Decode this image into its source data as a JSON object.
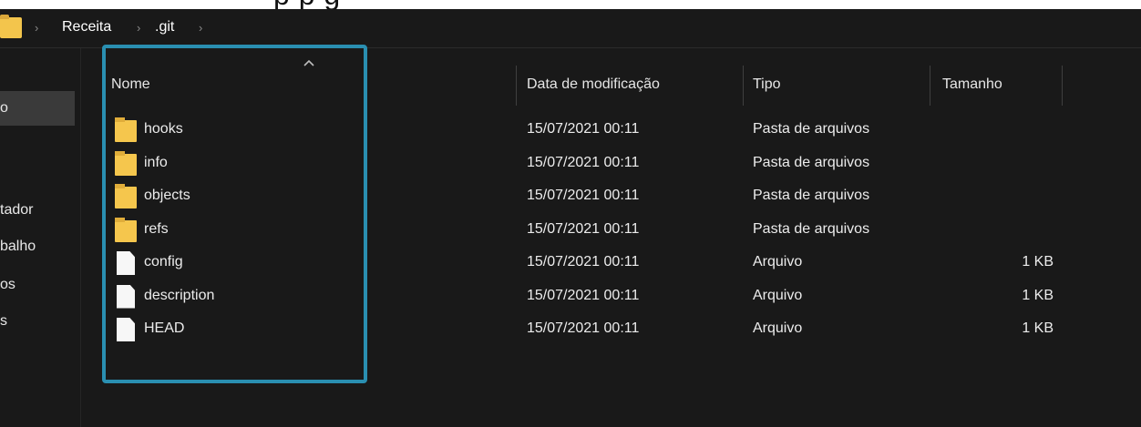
{
  "banner": {
    "text": "p                                    p      g"
  },
  "breadcrumb": {
    "items": [
      {
        "label": "Receita"
      },
      {
        "label": ".git"
      }
    ],
    "separator": "›"
  },
  "nav": {
    "items": [
      {
        "label": "o"
      },
      {
        "label": "tador"
      },
      {
        "label": "balho"
      },
      {
        "label": "os"
      },
      {
        "label": "s"
      }
    ]
  },
  "columns": {
    "name": "Nome",
    "date": "Data de modificação",
    "type": "Tipo",
    "size": "Tamanho"
  },
  "files": [
    {
      "name": "hooks",
      "date": "15/07/2021 00:11",
      "type": "Pasta de arquivos",
      "size": "",
      "kind": "folder-icon"
    },
    {
      "name": "info",
      "date": "15/07/2021 00:11",
      "type": "Pasta de arquivos",
      "size": "",
      "kind": "folder-icon"
    },
    {
      "name": "objects",
      "date": "15/07/2021 00:11",
      "type": "Pasta de arquivos",
      "size": "",
      "kind": "folder-icon"
    },
    {
      "name": "refs",
      "date": "15/07/2021 00:11",
      "type": "Pasta de arquivos",
      "size": "",
      "kind": "folder-icon"
    },
    {
      "name": "config",
      "date": "15/07/2021 00:11",
      "type": "Arquivo",
      "size": "1 KB",
      "kind": "file-icon"
    },
    {
      "name": "description",
      "date": "15/07/2021 00:11",
      "type": "Arquivo",
      "size": "1 KB",
      "kind": "file-icon"
    },
    {
      "name": "HEAD",
      "date": "15/07/2021 00:11",
      "type": "Arquivo",
      "size": "1 KB",
      "kind": "file-icon"
    }
  ],
  "colors": {
    "background": "#191919",
    "folder": "#f5c64d",
    "highlight": "#2a8fb1",
    "text": "#ececec"
  }
}
